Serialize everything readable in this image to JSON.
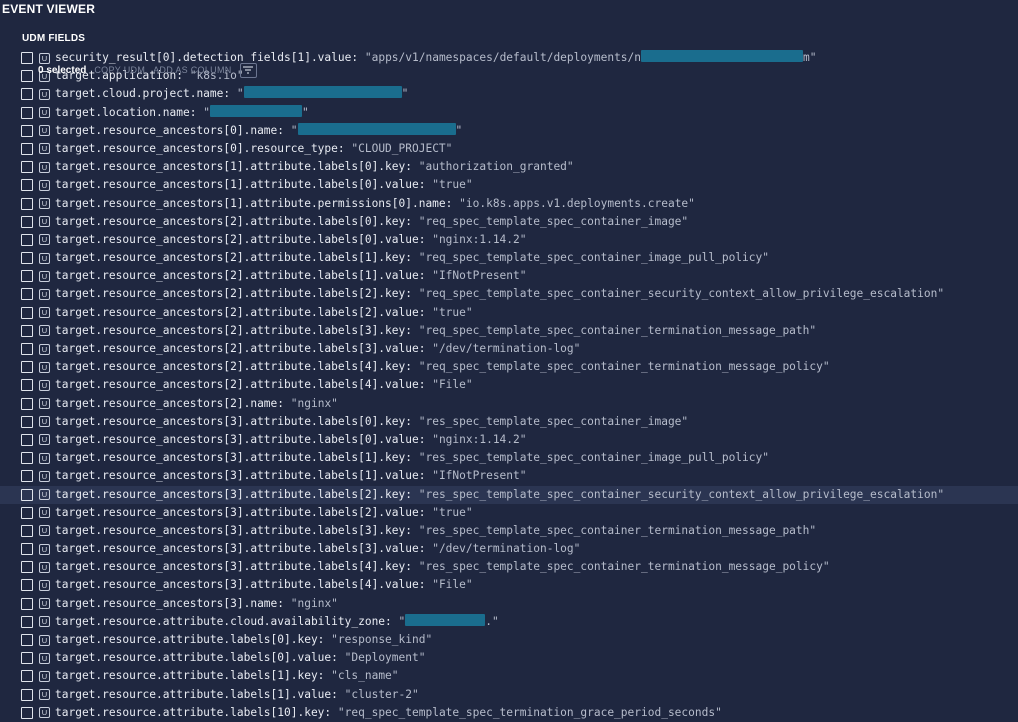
{
  "app": {
    "title": "EVENT VIEWER"
  },
  "section": {
    "title": "UDM FIELDS"
  },
  "selection": {
    "count_label": "0 selected",
    "copy_label": "COPY UDM",
    "add_label": "ADD AS COLUMN",
    "filter_icon": "filter-icon"
  },
  "badge_letter": "U",
  "colors": {
    "background": "#1f2740",
    "hover_row": "#2b3552",
    "redaction": "#1a6d8e"
  },
  "fields": [
    {
      "key": "security_result[0].detection_fields[1].value:",
      "value": "\"apps/v1/namespaces/default/deployments/n",
      "value_suffix": "m\"",
      "redacted": true
    },
    {
      "key": "target.application:",
      "value": "\"k8s.io\""
    },
    {
      "key": "target.cloud.project.name:",
      "value": "\"",
      "value_suffix": "\"",
      "redacted": true
    },
    {
      "key": "target.location.name:",
      "value": "\"",
      "value_suffix": "\"",
      "redacted": true
    },
    {
      "key": "target.resource_ancestors[0].name:",
      "value": "\"",
      "value_suffix": "\"",
      "redacted": true
    },
    {
      "key": "target.resource_ancestors[0].resource_type:",
      "value": "\"CLOUD_PROJECT\""
    },
    {
      "key": "target.resource_ancestors[1].attribute.labels[0].key:",
      "value": "\"authorization_granted\""
    },
    {
      "key": "target.resource_ancestors[1].attribute.labels[0].value:",
      "value": "\"true\""
    },
    {
      "key": "target.resource_ancestors[1].attribute.permissions[0].name:",
      "value": "\"io.k8s.apps.v1.deployments.create\""
    },
    {
      "key": "target.resource_ancestors[2].attribute.labels[0].key:",
      "value": "\"req_spec_template_spec_container_image\""
    },
    {
      "key": "target.resource_ancestors[2].attribute.labels[0].value:",
      "value": "\"nginx:1.14.2\""
    },
    {
      "key": "target.resource_ancestors[2].attribute.labels[1].key:",
      "value": "\"req_spec_template_spec_container_image_pull_policy\""
    },
    {
      "key": "target.resource_ancestors[2].attribute.labels[1].value:",
      "value": "\"IfNotPresent\""
    },
    {
      "key": "target.resource_ancestors[2].attribute.labels[2].key:",
      "value": "\"req_spec_template_spec_container_security_context_allow_privilege_escalation\""
    },
    {
      "key": "target.resource_ancestors[2].attribute.labels[2].value:",
      "value": "\"true\""
    },
    {
      "key": "target.resource_ancestors[2].attribute.labels[3].key:",
      "value": "\"req_spec_template_spec_container_termination_message_path\""
    },
    {
      "key": "target.resource_ancestors[2].attribute.labels[3].value:",
      "value": "\"/dev/termination-log\""
    },
    {
      "key": "target.resource_ancestors[2].attribute.labels[4].key:",
      "value": "\"req_spec_template_spec_container_termination_message_policy\""
    },
    {
      "key": "target.resource_ancestors[2].attribute.labels[4].value:",
      "value": "\"File\""
    },
    {
      "key": "target.resource_ancestors[2].name:",
      "value": "\"nginx\""
    },
    {
      "key": "target.resource_ancestors[3].attribute.labels[0].key:",
      "value": "\"res_spec_template_spec_container_image\""
    },
    {
      "key": "target.resource_ancestors[3].attribute.labels[0].value:",
      "value": "\"nginx:1.14.2\""
    },
    {
      "key": "target.resource_ancestors[3].attribute.labels[1].key:",
      "value": "\"res_spec_template_spec_container_image_pull_policy\""
    },
    {
      "key": "target.resource_ancestors[3].attribute.labels[1].value:",
      "value": "\"IfNotPresent\""
    },
    {
      "key": "target.resource_ancestors[3].attribute.labels[2].key:",
      "value": "\"res_spec_template_spec_container_security_context_allow_privilege_escalation\"",
      "hover": true
    },
    {
      "key": "target.resource_ancestors[3].attribute.labels[2].value:",
      "value": "\"true\""
    },
    {
      "key": "target.resource_ancestors[3].attribute.labels[3].key:",
      "value": "\"res_spec_template_spec_container_termination_message_path\""
    },
    {
      "key": "target.resource_ancestors[3].attribute.labels[3].value:",
      "value": "\"/dev/termination-log\""
    },
    {
      "key": "target.resource_ancestors[3].attribute.labels[4].key:",
      "value": "\"res_spec_template_spec_container_termination_message_policy\""
    },
    {
      "key": "target.resource_ancestors[3].attribute.labels[4].value:",
      "value": "\"File\""
    },
    {
      "key": "target.resource_ancestors[3].name:",
      "value": "\"nginx\""
    },
    {
      "key": "target.resource.attribute.cloud.availability_zone:",
      "value": "\"",
      "value_suffix": ".\"",
      "redacted": true
    },
    {
      "key": "target.resource.attribute.labels[0].key:",
      "value": "\"response_kind\""
    },
    {
      "key": "target.resource.attribute.labels[0].value:",
      "value": "\"Deployment\""
    },
    {
      "key": "target.resource.attribute.labels[1].key:",
      "value": "\"cls_name\""
    },
    {
      "key": "target.resource.attribute.labels[1].value:",
      "value": "\"cluster-2\""
    },
    {
      "key": "target.resource.attribute.labels[10].key:",
      "value": "\"req_spec_template_spec_termination_grace_period_seconds\""
    }
  ]
}
